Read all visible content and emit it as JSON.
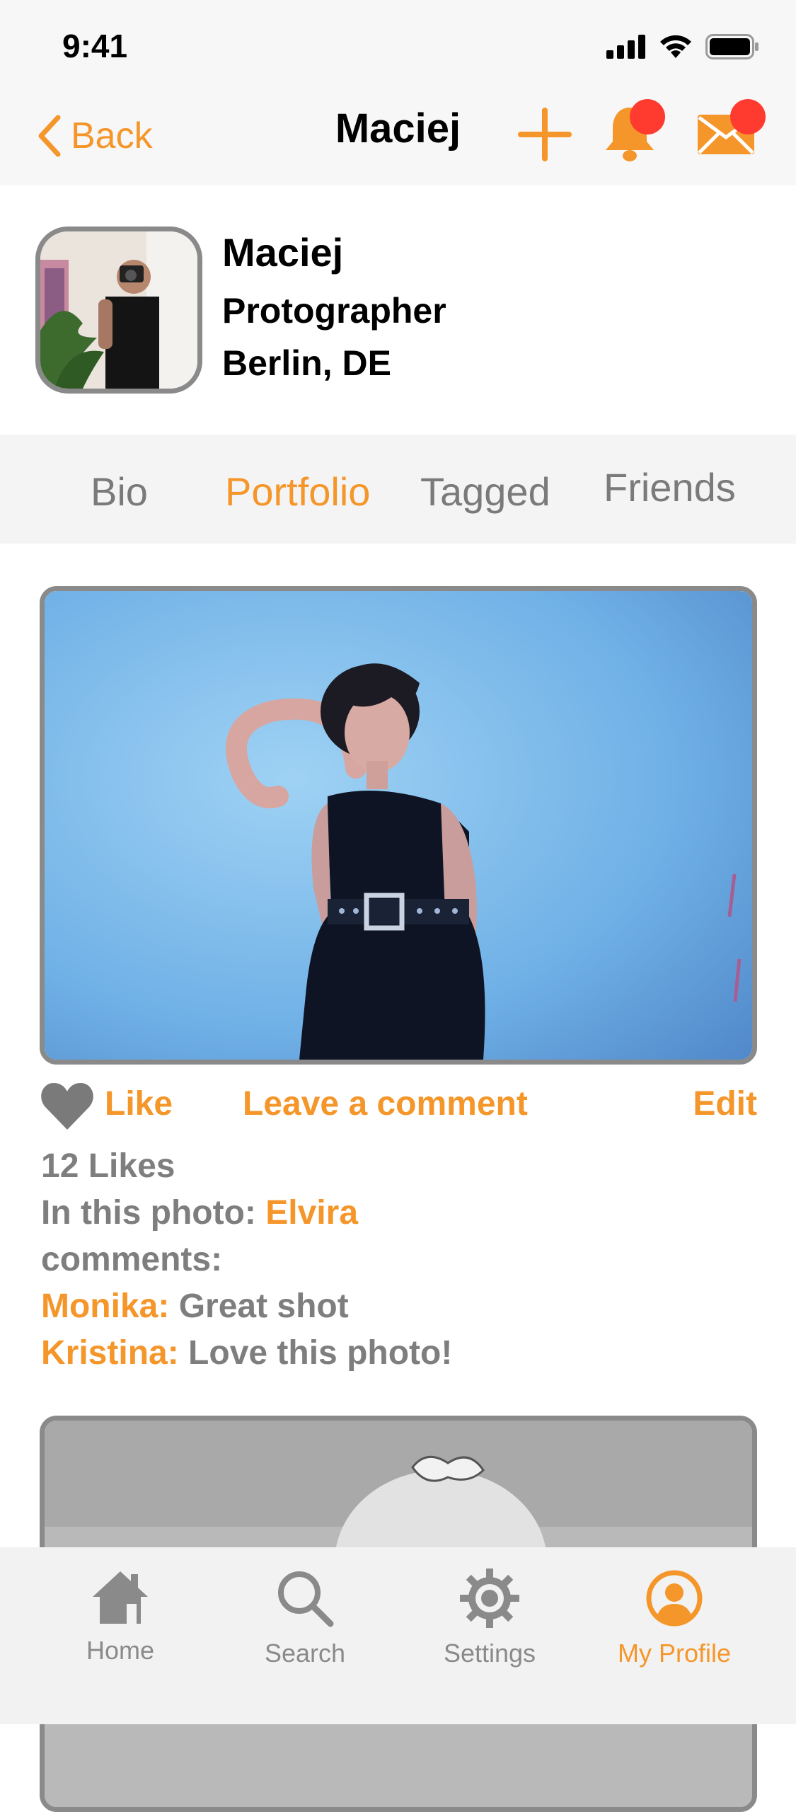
{
  "status_bar": {
    "time": "9:41"
  },
  "nav": {
    "back_label": "Back",
    "title": "Maciej"
  },
  "profile": {
    "name": "Maciej",
    "role": "Protographer",
    "location": "Berlin, DE"
  },
  "tabs": [
    {
      "label": "Bio",
      "active": false
    },
    {
      "label": "Portfolio",
      "active": true
    },
    {
      "label": "Tagged",
      "active": false
    },
    {
      "label": "Friends",
      "active": false
    }
  ],
  "post": {
    "like_label": "Like",
    "comment_label": "Leave a comment",
    "edit_label": "Edit",
    "likes": "12 Likes",
    "in_photo_prefix": "In this photo:",
    "in_photo_name": "Elvira",
    "comments_label": "comments:",
    "comments": [
      {
        "author": "Monika:",
        "text": "Great shot"
      },
      {
        "author": "Kristina:",
        "text": "Love this photo!"
      }
    ]
  },
  "tab_bar": {
    "items": [
      {
        "label": "Home",
        "icon": "home-icon"
      },
      {
        "label": "Search",
        "icon": "search-icon"
      },
      {
        "label": "Settings",
        "icon": "gear-icon"
      },
      {
        "label": "My Profile",
        "icon": "profile-icon",
        "active": true
      }
    ]
  },
  "colors": {
    "accent": "#f5962a",
    "badge": "#ff3b30",
    "muted": "#7e7e7e"
  }
}
